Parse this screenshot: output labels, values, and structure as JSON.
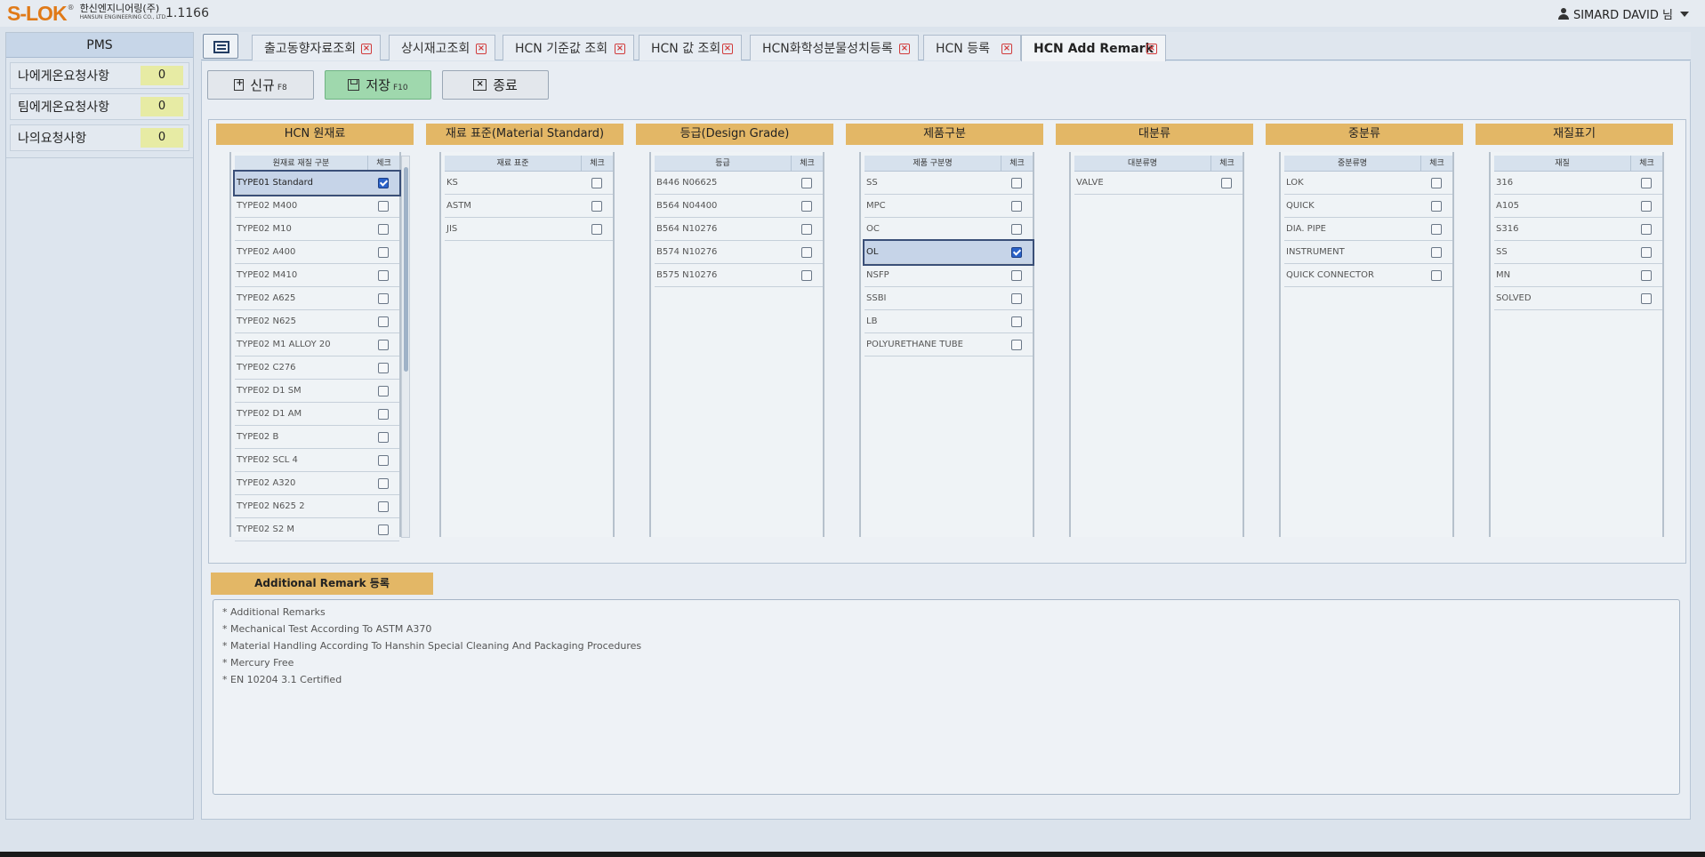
{
  "header": {
    "logo_mark": "S-LOK",
    "logo_reg": "®",
    "logo_ko": "한신엔지니어링(주)",
    "logo_en": "HANSUN ENGINEERING CO., LTD.",
    "version": "1.1166",
    "user_name": "SIMARD DAVID 님"
  },
  "sidebar": {
    "title": "PMS",
    "items": [
      {
        "label": "나에게온요청사항",
        "count": "0"
      },
      {
        "label": "팀에게온요청사항",
        "count": "0"
      },
      {
        "label": "나의요청사항",
        "count": "0"
      }
    ]
  },
  "tabs": [
    {
      "label": "출고동향자료조회"
    },
    {
      "label": "상시재고조회"
    },
    {
      "label": "HCN 기준값 조회"
    },
    {
      "label": "HCN 값 조회"
    },
    {
      "label": "HCN화학성분물성치등록"
    },
    {
      "label": "HCN 등록"
    },
    {
      "label": "HCN Add Remark"
    }
  ],
  "toolbar": {
    "new_label": "신규",
    "new_key": "F8",
    "save_label": "저장",
    "save_key": "F10",
    "exit_label": "종료"
  },
  "columns": [
    {
      "title": "HCN 원재료",
      "header": "원재료 재질 구분",
      "check_header": "체크",
      "rows": [
        "TYPE01 Standard",
        "TYPE02 M400",
        "TYPE02 M10",
        "TYPE02 A400",
        "TYPE02 M410",
        "TYPE02 A625",
        "TYPE02 N625",
        "TYPE02 M1 ALLOY 20",
        "TYPE02 C276",
        "TYPE02 D1 SM",
        "TYPE02 D1 AM",
        "TYPE02 B",
        "TYPE02 SCL 4",
        "TYPE02 A320",
        "TYPE02 N625 2",
        "TYPE02 S2 M"
      ],
      "checked": [
        true,
        false,
        false,
        false,
        false,
        false,
        false,
        false,
        false,
        false,
        false,
        false,
        false,
        false,
        false,
        false
      ]
    },
    {
      "title": "재료 표준(Material Standard)",
      "header": "재료 표준",
      "check_header": "체크",
      "rows": [
        "KS",
        "ASTM",
        "JIS"
      ],
      "checked": [
        false,
        false,
        false
      ]
    },
    {
      "title": "등급(Design Grade)",
      "header": "등급",
      "check_header": "체크",
      "rows": [
        "B446 N06625",
        "B564 N04400",
        "B564 N10276",
        "B574 N10276",
        "B575 N10276"
      ],
      "checked": [
        false,
        false,
        false,
        false,
        false
      ]
    },
    {
      "title": "제품구분",
      "header": "제품 구분명",
      "check_header": "체크",
      "rows": [
        "SS",
        "MPC",
        "OC",
        "OL",
        "NSFP",
        "SSBI",
        "LB",
        "POLYURETHANE TUBE"
      ],
      "checked": [
        false,
        false,
        false,
        true,
        false,
        false,
        false,
        false
      ]
    },
    {
      "title": "대분류",
      "header": "대분류명",
      "check_header": "체크",
      "rows": [
        "VALVE"
      ],
      "checked": [
        false
      ]
    },
    {
      "title": "중분류",
      "header": "중분류명",
      "check_header": "체크",
      "rows": [
        "LOK",
        "QUICK",
        "DIA. PIPE",
        "INSTRUMENT",
        "QUICK CONNECTOR"
      ],
      "checked": [
        false,
        false,
        false,
        false,
        false
      ]
    },
    {
      "title": "재질표기",
      "header": "재질",
      "check_header": "체크",
      "rows": [
        "316",
        "A105",
        "S316",
        "SS",
        "MN",
        "SOLVED"
      ],
      "checked": [
        false,
        false,
        false,
        false,
        false,
        false
      ]
    }
  ],
  "remark": {
    "title": "Additional Remark 등록",
    "lines": [
      "* Additional Remarks",
      "* Mechanical Test According To ASTM A370",
      "* Material Handling According To Hanshin Special Cleaning And Packaging Procedures",
      "* Mercury Free",
      "* EN 10204 3.1 Certified"
    ]
  },
  "colors": {
    "accent_header": "#e3b766",
    "save_button": "#9fd8ad",
    "check_on": "#2a62c9"
  }
}
